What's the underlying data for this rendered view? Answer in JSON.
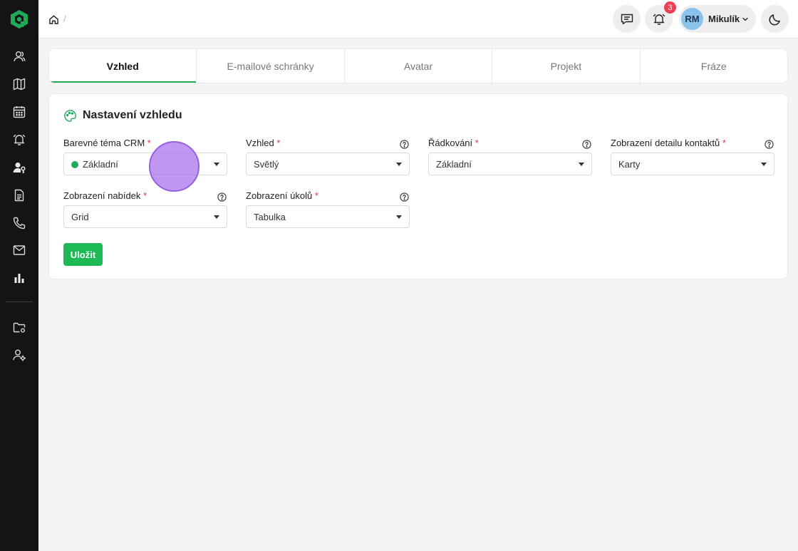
{
  "header": {
    "breadcrumb_separator": "/",
    "notifications_count": "3",
    "user": {
      "initials": "RM",
      "name": "Mikulík"
    }
  },
  "tabs": [
    {
      "label": "Vzhled",
      "active": true
    },
    {
      "label": "E-mailové schránky",
      "active": false
    },
    {
      "label": "Avatar",
      "active": false
    },
    {
      "label": "Projekt",
      "active": false
    },
    {
      "label": "Fráze",
      "active": false
    }
  ],
  "appearance": {
    "title": "Nastavení vzhledu",
    "required_marker": "*",
    "fields": {
      "theme": {
        "label": "Barevné téma CRM",
        "value": "Základní",
        "dot_color": "#1faa59"
      },
      "look": {
        "label": "Vzhled",
        "value": "Světlý"
      },
      "spacing": {
        "label": "Řádkování",
        "value": "Základní"
      },
      "contact_detail": {
        "label": "Zobrazení detailu kontaktů",
        "value": "Karty"
      },
      "offers": {
        "label": "Zobrazení nabídek",
        "value": "Grid"
      },
      "tasks": {
        "label": "Zobrazení úkolů",
        "value": "Tabulka"
      }
    },
    "save_label": "Uložit"
  },
  "colors": {
    "accent": "#1faa59",
    "save_button": "#1db954",
    "sidebar": "#141414",
    "badge": "#ef3f55",
    "avatar": "#8bc2ec"
  },
  "sidebar_icons": [
    "contacts-icon",
    "map-icon",
    "calendar-icon",
    "alarm-bell-icon",
    "user-key-icon",
    "document-icon",
    "phone-icon",
    "mail-icon",
    "bar-chart-icon",
    "folder-settings-icon",
    "user-settings-icon"
  ]
}
